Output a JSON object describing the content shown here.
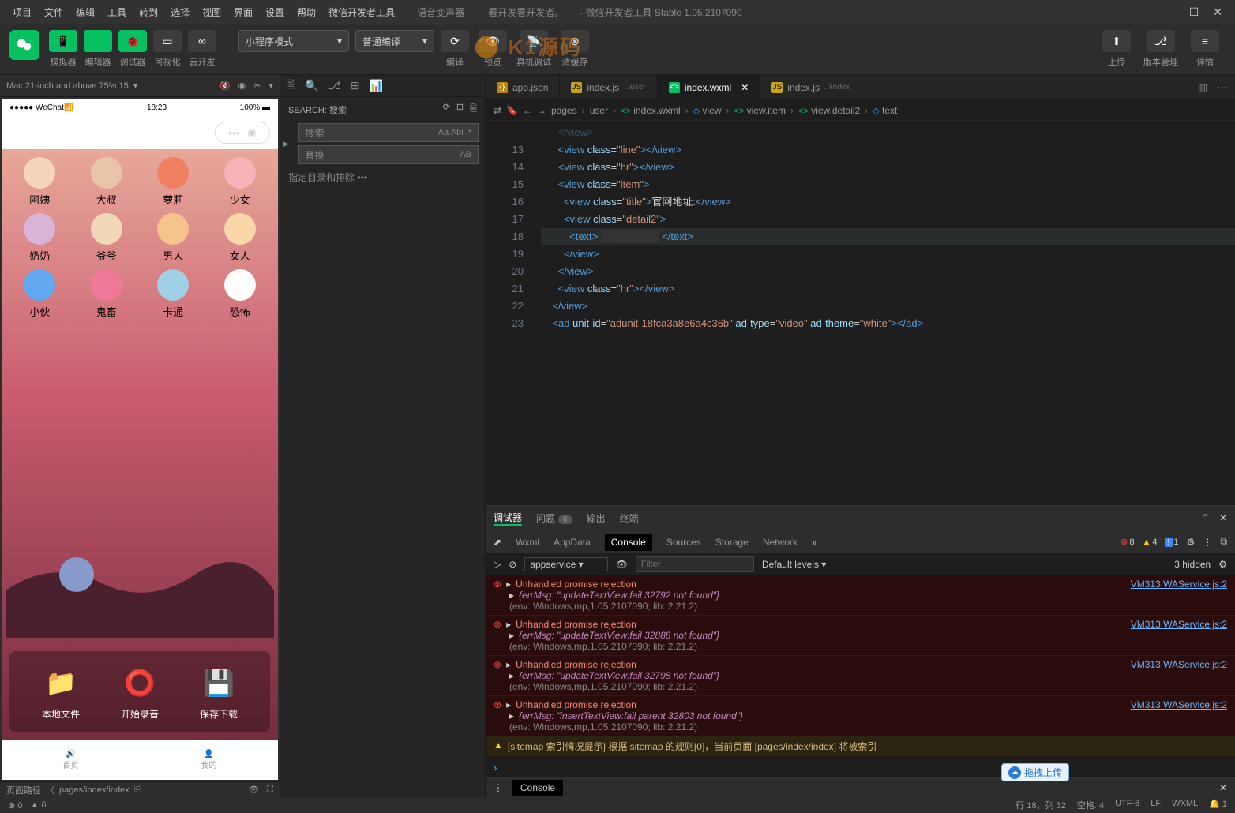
{
  "titlebar": {
    "menus": [
      "项目",
      "文件",
      "编辑",
      "工具",
      "转到",
      "选择",
      "视图",
      "界面",
      "设置",
      "帮助",
      "微信开发者工具"
    ],
    "appTitle": "语音变声器",
    "subtitle": "看开发看开发者。",
    "fullTitle": "- 微信开发者工具 Stable 1.05.2107090"
  },
  "toolbar": {
    "tools": [
      {
        "icon": "📱",
        "label": "模拟器"
      },
      {
        "icon": "</>",
        "label": "编辑器"
      },
      {
        "icon": "🐞",
        "label": "调试器"
      },
      {
        "icon": "▭",
        "label": "可视化"
      },
      {
        "icon": "∞",
        "label": "云开发"
      }
    ],
    "modeCombo": "小程序模式",
    "compileCombo": "普通编译",
    "centerTools": [
      {
        "icon": "⟳",
        "label": "编译"
      },
      {
        "icon": "👁",
        "label": "预览"
      },
      {
        "icon": "📡",
        "label": "真机调试"
      },
      {
        "icon": "⊗",
        "label": "清缓存"
      }
    ],
    "rightTools": [
      {
        "icon": "⬆",
        "label": "上传"
      },
      {
        "icon": "⎇",
        "label": "版本管理"
      },
      {
        "icon": "≡",
        "label": "详情"
      }
    ]
  },
  "simulator": {
    "device": "Mac 21-inch and above 75% 15",
    "statusTime": "18:23",
    "statusBattery": "100%",
    "wechat": "WeChat",
    "voices": [
      {
        "label": "阿姨",
        "color": "#f4d4bc"
      },
      {
        "label": "大叔",
        "color": "#e8c4a8"
      },
      {
        "label": "萝莉",
        "color": "#f08060"
      },
      {
        "label": "少女",
        "color": "#f4b4b8"
      },
      {
        "label": "奶奶",
        "color": "#d8b4d8"
      },
      {
        "label": "爷爷",
        "color": "#f0d8b8"
      },
      {
        "label": "男人",
        "color": "#f4c48c"
      },
      {
        "label": "女人",
        "color": "#f8d8a8"
      },
      {
        "label": "小伙",
        "color": "#60a8f0"
      },
      {
        "label": "鬼畜",
        "color": "#f07898"
      },
      {
        "label": "卡通",
        "color": "#a0d0e8"
      },
      {
        "label": "恐怖",
        "color": "#ffffff"
      }
    ],
    "actions": [
      {
        "icon": "📁",
        "label": "本地文件"
      },
      {
        "icon": "⭕",
        "label": "开始录音"
      },
      {
        "icon": "💾",
        "label": "保存下载"
      }
    ],
    "tabs": [
      {
        "icon": "🔊",
        "label": "首页"
      },
      {
        "icon": "👤",
        "label": "我的"
      }
    ],
    "pagePath": "页面路径",
    "pagePathValue": "pages/index/index"
  },
  "search": {
    "label": "SEARCH: 搜索",
    "placeholder": "搜索",
    "replacePlaceholder": "替换",
    "excludeLabel": "指定目录和排除",
    "opts1": "Aa Abl .*",
    "opts2": "AB"
  },
  "tabs": [
    {
      "type": "json",
      "name": "app.json"
    },
    {
      "type": "js",
      "name": "index.js",
      "path": "..\\user"
    },
    {
      "type": "wxml",
      "name": "index.wxml",
      "active": true
    },
    {
      "type": "js",
      "name": "index.js",
      "path": "..\\index"
    }
  ],
  "breadcrumb": [
    "pages",
    "user",
    "index.wxml",
    "view",
    "view.item",
    "view.detail2",
    "text"
  ],
  "code": {
    "startLine": 13,
    "lines": [
      {
        "indent": 3,
        "html": "<span class='tag'>&lt;view</span> <span class='attr'>class</span>=<span class='str'>\"line\"</span><span class='tag'>&gt;&lt;/view&gt;</span>"
      },
      {
        "indent": 3,
        "html": "<span class='tag'>&lt;view</span> <span class='attr'>class</span>=<span class='str'>\"hr\"</span><span class='tag'>&gt;&lt;/view&gt;</span>"
      },
      {
        "indent": 3,
        "html": "<span class='tag'>&lt;view</span> <span class='attr'>class</span>=<span class='str'>\"item\"</span><span class='tag'>&gt;</span>"
      },
      {
        "indent": 4,
        "html": "<span class='tag'>&lt;view</span> <span class='attr'>class</span>=<span class='str'>\"title\"</span><span class='tag'>&gt;</span><span class='txt'>官网地址:</span><span class='tag'>&lt;/view&gt;</span>"
      },
      {
        "indent": 4,
        "html": "<span class='tag'>&lt;view</span> <span class='attr'>class</span>=<span class='str'>\"detail2\"</span><span class='tag'>&gt;</span>"
      },
      {
        "indent": 5,
        "html": "<span class='tag'>&lt;text&gt;</span> <span style='background:#333;color:#333'>████████</span> <span class='tag'>&lt;/text&gt;</span>",
        "hl": true
      },
      {
        "indent": 4,
        "html": "<span class='tag'>&lt;/view&gt;</span>"
      },
      {
        "indent": 3,
        "html": "<span class='tag'>&lt;/view&gt;</span>"
      },
      {
        "indent": 3,
        "html": "<span class='tag'>&lt;view</span> <span class='attr'>class</span>=<span class='str'>\"hr\"</span><span class='tag'>&gt;&lt;/view&gt;</span>"
      },
      {
        "indent": 2,
        "html": "<span class='tag'>&lt;/view&gt;</span>"
      },
      {
        "indent": 2,
        "html": "<span class='tag'>&lt;ad</span> <span class='attr'>unit-id</span>=<span class='str'>\"adunit-18fca3a8e6a4c36b\"</span> <span class='attr'>ad-type</span>=<span class='str'>\"video\"</span> <span class='attr'>ad-theme</span>=<span class='str'>\"white\"</span><span class='tag'>&gt;&lt;/ad&gt;</span>"
      }
    ]
  },
  "debug": {
    "tabs": [
      "调试器",
      "问题",
      "输出",
      "终端"
    ],
    "problemCount": "6",
    "devtabs": [
      "Wxml",
      "AppData",
      "Console",
      "Sources",
      "Storage",
      "Network"
    ],
    "errors": "8",
    "warns": "4",
    "info": "1",
    "hidden": "3 hidden",
    "context": "appservice",
    "filterPlaceholder": "Filter",
    "levels": "Default levels",
    "logs": [
      {
        "title": "Unhandled promise rejection",
        "msg": "{errMsg: \"updateTextView:fail 32792 not found\"}",
        "env": "(env: Windows,mp,1.05.2107090; lib: 2.21.2)",
        "link": "VM313 WAService.js:2"
      },
      {
        "title": "Unhandled promise rejection",
        "msg": "{errMsg: \"updateTextView:fail 32888 not found\"}",
        "env": "(env: Windows,mp,1.05.2107090; lib: 2.21.2)",
        "link": "VM313 WAService.js:2"
      },
      {
        "title": "Unhandled promise rejection",
        "msg": "{errMsg: \"updateTextView:fail 32798 not found\"}",
        "env": "(env: Windows,mp,1.05.2107090; lib: 2.21.2)",
        "link": "VM313 WAService.js:2"
      },
      {
        "title": "Unhandled promise rejection",
        "msg": "{errMsg: \"insertTextView:fail parent 32803 not found\"}",
        "env": "(env: Windows,mp,1.05.2107090; lib: 2.21.2)",
        "link": "VM313 WAService.js:2"
      }
    ],
    "sitemapMsg": "[sitemap 索引情况提示] 根据 sitemap 的规则[0]，当前页面 [pages/index/index] 将被索引",
    "consoleLabel": "Console"
  },
  "status": {
    "errors": "0",
    "warns": "6",
    "line": "行 18，列 32",
    "spaces": "空格: 4",
    "enc": "UTF-8",
    "eol": "LF",
    "lang": "WXML",
    "bell": "1"
  },
  "baidu": "拖拽上传",
  "watermark": "K1源码"
}
